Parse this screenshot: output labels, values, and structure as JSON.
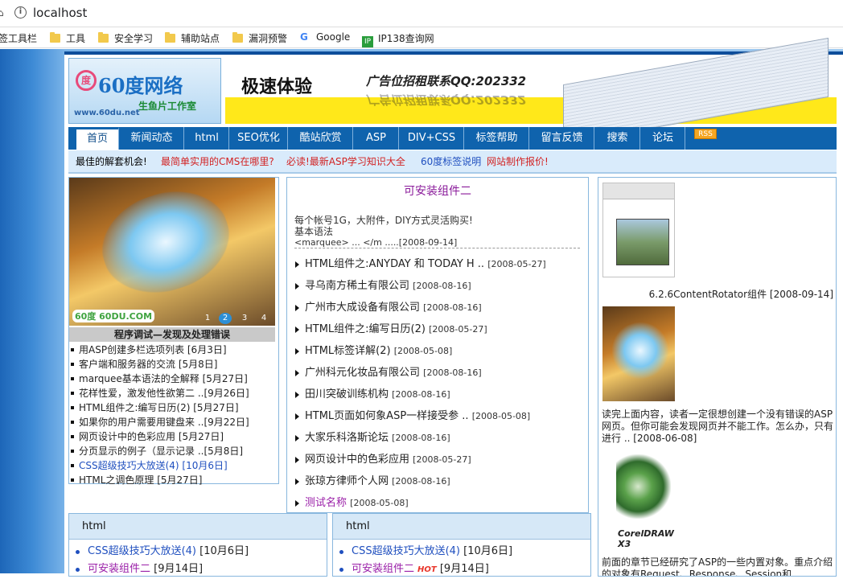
{
  "browser": {
    "url": "localhost",
    "home_glyph": "⌂",
    "bookmarks": [
      {
        "label": "签工具栏",
        "icon": "none"
      },
      {
        "label": "工具",
        "icon": "folder-icon"
      },
      {
        "label": "安全学习",
        "icon": "folder-icon"
      },
      {
        "label": "辅助站点",
        "icon": "folder-icon"
      },
      {
        "label": "漏洞预警",
        "icon": "folder-icon"
      },
      {
        "label": "Google",
        "icon": "google-icon"
      },
      {
        "label": "IP138查询网",
        "icon": "ip138-icon"
      }
    ]
  },
  "banner": {
    "logo_main": "60度网络",
    "logo_sub": "生鱼片工作室",
    "logo_url": "www.60du.net",
    "ad_slogan": "极速体验",
    "ad_contact": "广告位招租联系QQ:202332"
  },
  "nav": {
    "items": [
      "首页",
      "新闻动态",
      "html",
      "SEO优化",
      "酷站欣赏",
      "ASP",
      "DIV+CSS",
      "标签帮助",
      "留言反馈",
      "搜索",
      "论坛"
    ],
    "rss": "RSS"
  },
  "subbar": {
    "items": [
      {
        "text": "最佳的解套机会!",
        "color": "#222222"
      },
      {
        "text": "最简单实用的CMS在哪里?",
        "color": "#d22222"
      },
      {
        "text": "必读!最新ASP学习知识大全",
        "color": "#d22222"
      },
      {
        "text": "60度标签说明",
        "color": "#1f4fbf"
      },
      {
        "text": "网站制作报价!",
        "color": "#d22222"
      }
    ]
  },
  "slideshow": {
    "caption": "程序调试—发现及处理错误",
    "logo": "60度 60DU.COM",
    "dots": [
      "1",
      "2",
      "3",
      "4"
    ],
    "active_dot": 2
  },
  "left_list": [
    {
      "text": "用ASP创建多栏选项列表 [6月3日]",
      "style": "normal"
    },
    {
      "text": "客户端和服务器的交流 [5月8日]",
      "style": "normal"
    },
    {
      "text": "marquee基本语法的全解释 [5月27日]",
      "style": "normal"
    },
    {
      "text": "花样性爱，激发他性欲第二 ..[9月26日]",
      "style": "normal"
    },
    {
      "text": "HTML组件之:编写日历(2) [5月27日]",
      "style": "normal"
    },
    {
      "text": "如果你的用户需要用键盘来 ..[9月22日]",
      "style": "normal"
    },
    {
      "text": "网页设计中的色彩应用 [5月27日]",
      "style": "normal"
    },
    {
      "text": "分页显示的例子（显示记录 ..[5月8日]",
      "style": "normal"
    },
    {
      "text": "CSS超级技巧大放送(4) [10月6日]",
      "style": "blue"
    },
    {
      "text": "HTML之调色原理 [5月27日]",
      "style": "normal"
    }
  ],
  "center": {
    "title": "可安装组件二",
    "desc_line1": "每个帐号1G，大附件，DIY方式灵活购买!",
    "desc_line2": "基本语法",
    "desc_line3": "<marquee> ... </m .....[2008-09-14]",
    "list": [
      {
        "title": "HTML组件之:ANYDAY 和 TODAY H ..",
        "date": "[2008-05-27]",
        "style": "normal"
      },
      {
        "title": "寻乌南方稀土有限公司",
        "date": "[2008-08-16]",
        "style": "normal"
      },
      {
        "title": "广州市大成设备有限公司",
        "date": "[2008-08-16]",
        "style": "normal"
      },
      {
        "title": "HTML组件之:编写日历(2)",
        "date": "[2008-05-27]",
        "style": "normal"
      },
      {
        "title": "HTML标签详解(2)",
        "date": "[2008-05-08]",
        "style": "normal"
      },
      {
        "title": "广州科元化妆品有限公司",
        "date": "[2008-08-16]",
        "style": "normal"
      },
      {
        "title": "田川突破训练机构",
        "date": "[2008-08-16]",
        "style": "normal"
      },
      {
        "title": "HTML页面如何象ASP一样接受参 ..",
        "date": "[2008-05-08]",
        "style": "normal"
      },
      {
        "title": "大家乐科洛斯论坛",
        "date": "[2008-08-16]",
        "style": "normal"
      },
      {
        "title": "网页设计中的色彩应用",
        "date": "[2008-05-27]",
        "style": "normal"
      },
      {
        "title": "张琼方律师个人网",
        "date": "[2008-08-16]",
        "style": "normal"
      },
      {
        "title": "测试名称",
        "date": "[2008-05-08]",
        "style": "purple"
      }
    ]
  },
  "right": {
    "caption1": "6.2.6ContentRotator组件 [2008-09-14]",
    "text1": "读完上面内容，读者一定很想创建一个没有错误的ASP网页。但你可能会发现网页并不能工作。怎么办，只有进行 .. [2008-06-08]",
    "img3_label": "CorelDRAW X3",
    "text2": "前面的章节已经研究了ASP的一些内置对象。重点介绍的对象有Request、Response、Session和Application"
  },
  "bottom_boxes": [
    {
      "head": "html",
      "items": [
        {
          "title": "CSS超级技巧大放送(4)",
          "date": "[10月6日]",
          "style": "blue",
          "hot": ""
        },
        {
          "title": "可安装组件二",
          "date": "[9月14日]",
          "style": "purple",
          "hot": ""
        }
      ]
    },
    {
      "head": "html",
      "items": [
        {
          "title": "CSS超级技巧大放送(4)",
          "date": "[10月6日]",
          "style": "blue",
          "hot": ""
        },
        {
          "title": "可安装组件二",
          "date": "[9月14日]",
          "style": "purple",
          "hot": "HOT"
        }
      ]
    }
  ]
}
